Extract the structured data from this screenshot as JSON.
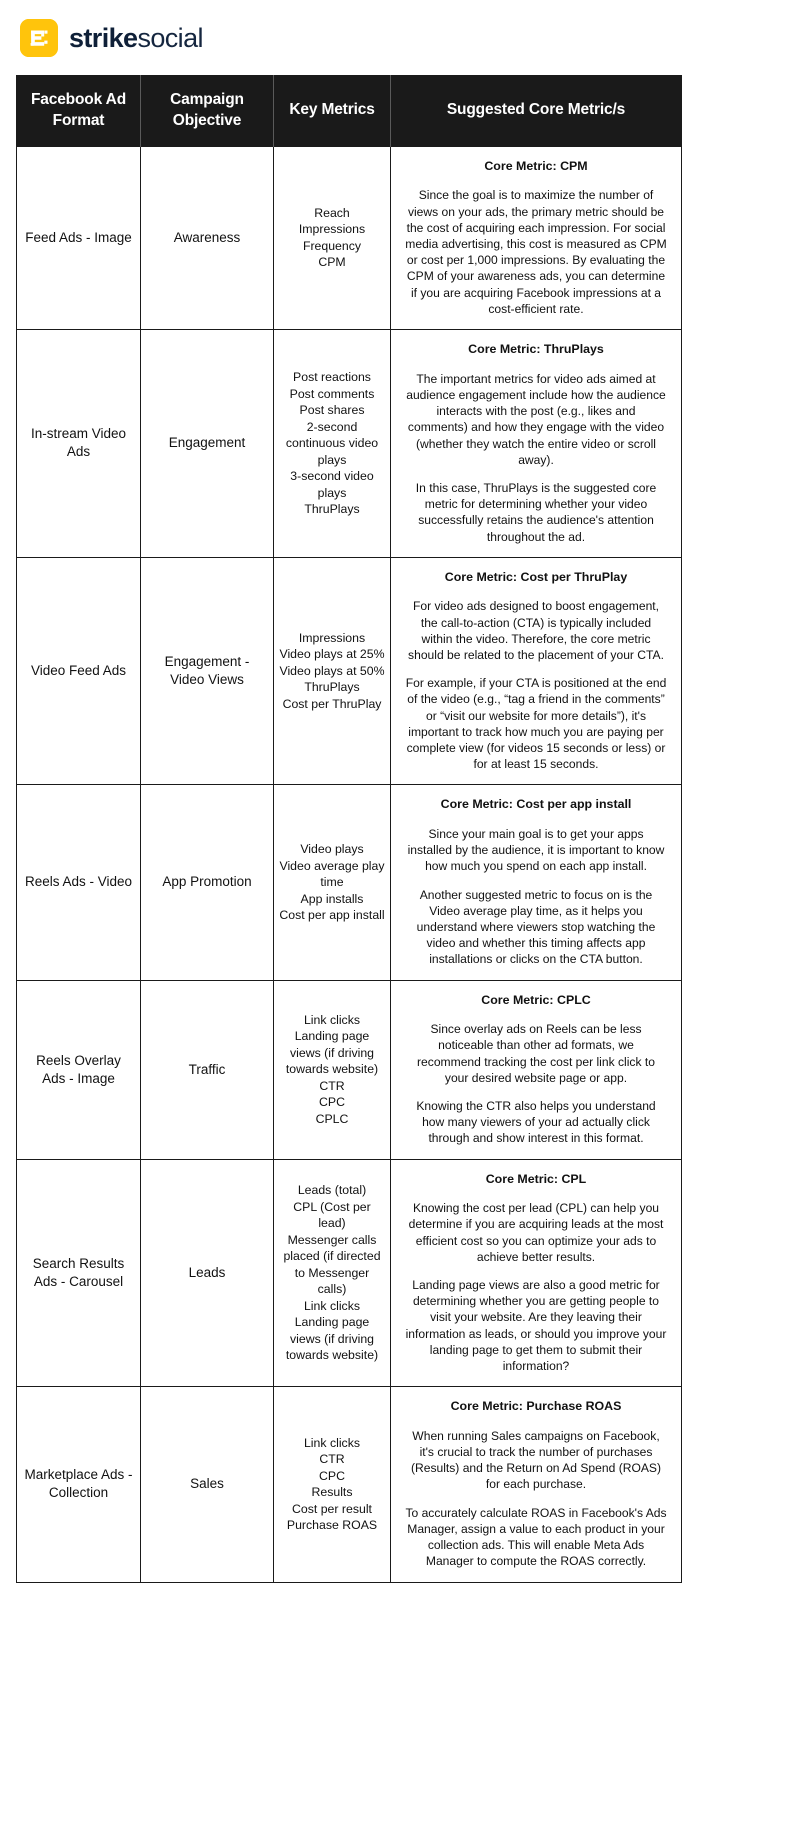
{
  "brand": {
    "logo_icon": "strike-social-logo-icon",
    "logo_bg_color": "#FFC40C",
    "name_bold": "strike",
    "name_light": "social"
  },
  "table": {
    "headers": [
      "Facebook Ad Format",
      "Campaign Objective",
      "Key Metrics",
      "Suggested Core Metric/s"
    ],
    "rows": [
      {
        "format": "Feed Ads - Image",
        "objective": "Awareness",
        "metrics": [
          "Reach",
          "Impressions",
          "Frequency",
          "CPM"
        ],
        "core_title": "Core Metric: CPM",
        "core_paragraphs": [
          "Since the goal is to maximize the number of views on your ads, the primary metric should be the cost of acquiring each impression. For social media advertising, this cost is measured as CPM or cost per 1,000 impressions. By evaluating the CPM of your awareness ads, you can determine if you are acquiring Facebook impressions at a cost-efficient rate."
        ]
      },
      {
        "format": "In-stream Video Ads",
        "objective": "Engagement",
        "metrics": [
          "Post reactions",
          "Post comments",
          "Post shares",
          "2-second continuous video plays",
          "3-second video plays",
          "ThruPlays"
        ],
        "core_title": "Core Metric: ThruPlays",
        "core_paragraphs": [
          "The important metrics for video ads aimed at audience engagement include how the audience interacts with the post (e.g., likes and comments) and how they engage with the video (whether they watch the entire video or scroll away).",
          "In this case, ThruPlays is the suggested core metric for determining whether your video successfully retains the audience's attention throughout the ad."
        ]
      },
      {
        "format": "Video Feed Ads",
        "objective": "Engagement - Video Views",
        "metrics": [
          "Impressions",
          "Video plays at 25%",
          "Video plays at 50%",
          "ThruPlays",
          "Cost per ThruPlay"
        ],
        "core_title": "Core Metric: Cost per ThruPlay",
        "core_paragraphs": [
          "For video ads designed to boost engagement, the call-to-action (CTA) is typically included within the video. Therefore, the core metric should be related to the placement of your CTA.",
          "For example, if your CTA is positioned at the end of the video (e.g., “tag a friend in the comments” or “visit our website for more details”), it's important to track how much you are paying per complete view (for videos 15 seconds or less) or for at least 15 seconds."
        ]
      },
      {
        "format": "Reels Ads - Video",
        "objective": "App Promotion",
        "metrics": [
          "Video plays",
          "Video average play time",
          "App installs",
          "Cost per app install"
        ],
        "core_title": "Core Metric: Cost per app install",
        "core_paragraphs": [
          "Since your main goal is to get your apps installed by the audience, it is important to know how much you spend on each app install.",
          "Another suggested metric to focus on is the Video average play time, as it helps you understand where viewers stop watching the video and whether this timing affects app installations or clicks on the CTA button."
        ]
      },
      {
        "format": "Reels Overlay Ads - Image",
        "objective": "Traffic",
        "metrics": [
          "Link clicks",
          "Landing page views (if driving towards website)",
          "CTR",
          "CPC",
          "CPLC"
        ],
        "core_title": "Core Metric: CPLC",
        "core_paragraphs": [
          "Since overlay ads on Reels can be less noticeable than other ad formats, we recommend tracking the cost per link click to your desired website page or app.",
          "Knowing the CTR also helps you understand how many viewers of your ad actually click through and show interest in this format."
        ]
      },
      {
        "format": "Search Results Ads - Carousel",
        "objective": "Leads",
        "metrics": [
          "Leads (total)",
          "CPL (Cost per lead)",
          "Messenger calls placed (if directed to Messenger calls)",
          "Link clicks",
          "Landing page views (if driving towards website)"
        ],
        "core_title": "Core Metric: CPL",
        "core_paragraphs": [
          "Knowing the cost per lead (CPL) can help you determine if you are acquiring leads at the most efficient cost so you can optimize your ads to achieve better results.",
          "Landing page views are also a good metric for determining whether you are getting people to visit your website. Are they leaving their information as leads, or should you improve your landing page to get them to submit their information?"
        ]
      },
      {
        "format": "Marketplace Ads - Collection",
        "objective": "Sales",
        "metrics": [
          "Link clicks",
          "CTR",
          "CPC",
          "Results",
          "Cost per result",
          "Purchase ROAS"
        ],
        "core_title": "Core Metric: Purchase ROAS",
        "core_paragraphs": [
          "When running Sales campaigns on Facebook, it's crucial to track the number of purchases (Results) and the Return on Ad Spend (ROAS) for each purchase.",
          "To accurately calculate ROAS in Facebook's Ads Manager, assign a value to each product in your collection ads. This will enable Meta Ads Manager to compute the ROAS correctly."
        ]
      }
    ]
  }
}
